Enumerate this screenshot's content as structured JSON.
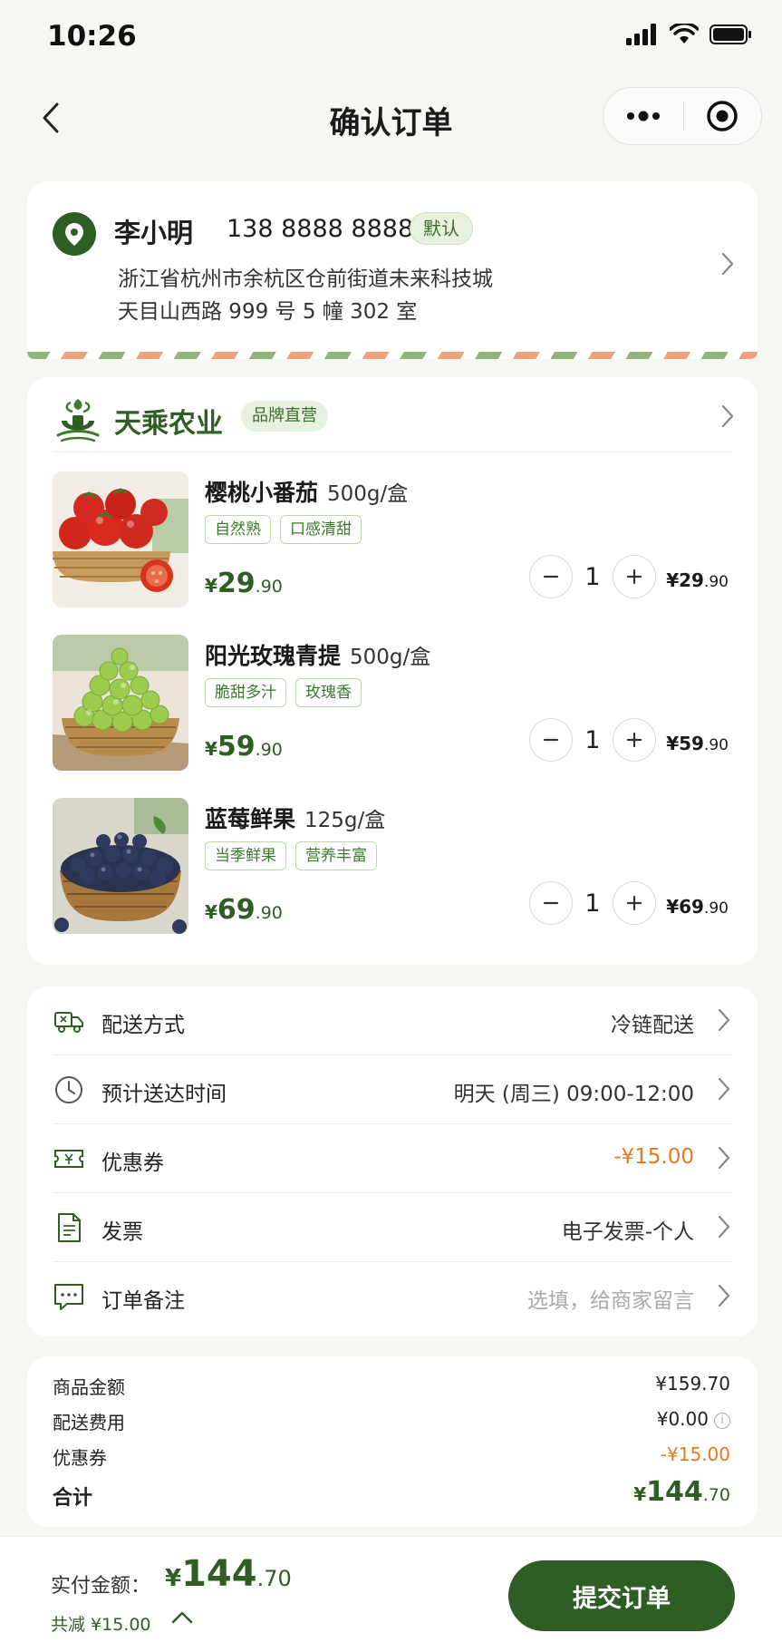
{
  "status_bar": {
    "time": "10:26"
  },
  "nav": {
    "title": "确认订单"
  },
  "address": {
    "name": "李小明",
    "phone": "138 8888 8888",
    "default_badge": "默认",
    "line1": "浙江省杭州市余杭区仓前街道未来科技城",
    "line2": "天目山西路 999 号 5 幢 302 室"
  },
  "store": {
    "name": "天乘农业",
    "badge": "品牌直营",
    "products": [
      {
        "name": "樱桃小番茄",
        "spec": "500g/盒",
        "tags": [
          "自然熟",
          "口感清甜"
        ],
        "currency": "¥",
        "price_int": "29",
        "price_dec": ".90",
        "qty": "1",
        "subtotal_int": "¥29",
        "subtotal_dec": ".90",
        "image": "tomato"
      },
      {
        "name": "阳光玫瑰青提",
        "spec": "500g/盒",
        "tags": [
          "脆甜多汁",
          "玫瑰香"
        ],
        "currency": "¥",
        "price_int": "59",
        "price_dec": ".90",
        "qty": "1",
        "subtotal_int": "¥59",
        "subtotal_dec": ".90",
        "image": "grape"
      },
      {
        "name": "蓝莓鲜果",
        "spec": "125g/盒",
        "tags": [
          "当季鲜果",
          "营养丰富"
        ],
        "currency": "¥",
        "price_int": "69",
        "price_dec": ".90",
        "qty": "1",
        "subtotal_int": "¥69",
        "subtotal_dec": ".90",
        "image": "blueberry"
      }
    ]
  },
  "options": [
    {
      "icon": "truck-icon",
      "label": "配送方式",
      "value": "冷链配送",
      "style": "normal"
    },
    {
      "icon": "clock-icon",
      "label": "预计送达时间",
      "value": "明天 (周三) 09:00-12:00",
      "style": "normal"
    },
    {
      "icon": "coupon-icon",
      "label": "优惠券",
      "value": "-¥15.00",
      "style": "orange"
    },
    {
      "icon": "invoice-icon",
      "label": "发票",
      "value": "电子发票-个人",
      "style": "normal"
    },
    {
      "icon": "message-icon",
      "label": "订单备注",
      "value": "选填，给商家留言",
      "style": "hint"
    }
  ],
  "summary": {
    "goods_label": "商品金额",
    "goods_value": "¥159.70",
    "shipping_label": "配送费用",
    "shipping_value": "¥0.00",
    "coupon_label": "优惠券",
    "coupon_value": "-¥15.00",
    "total_label": "合计",
    "total_currency": "¥",
    "total_int": "144",
    "total_dec": ".70"
  },
  "bottom": {
    "pay_label": "实付金额：",
    "pay_currency": "¥",
    "pay_int": "144",
    "pay_dec": ".70",
    "saved": "共减 ¥15.00",
    "submit_label": "提交订单"
  },
  "colors": {
    "brand_green": "#2f5e25",
    "discount_orange": "#e8781d"
  }
}
